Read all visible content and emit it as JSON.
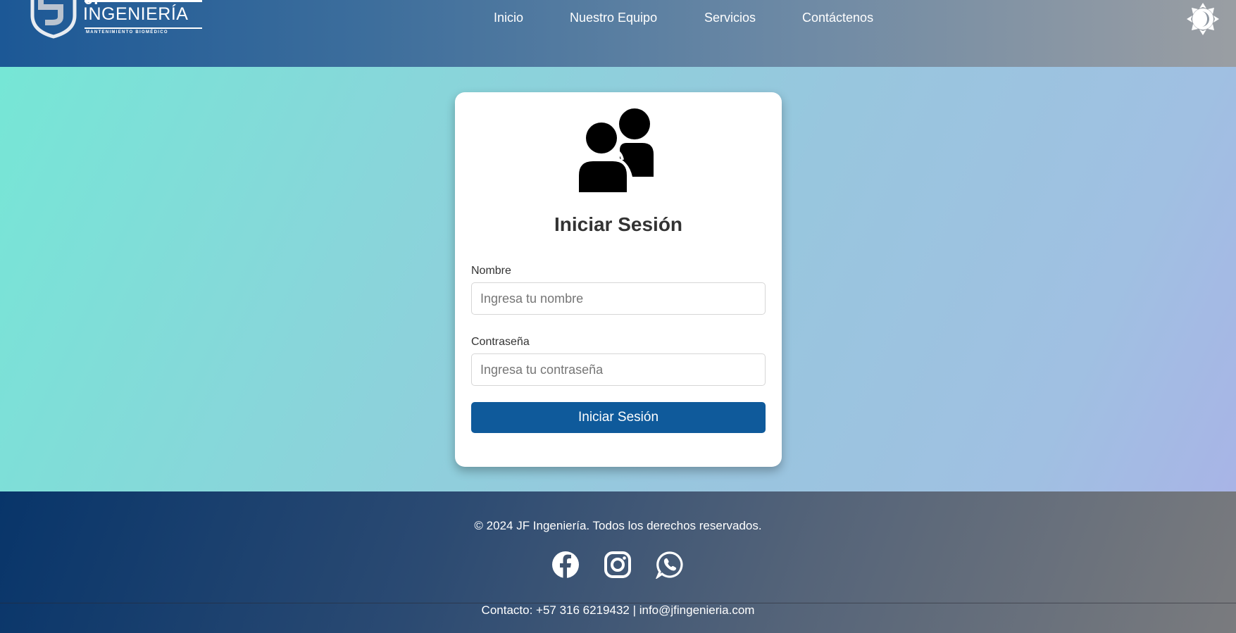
{
  "header": {
    "logo": {
      "brand_top": "JF",
      "brand_name": "INGENIERÍA",
      "tagline": "MANTENIMIENTO BIOMÉDICO"
    },
    "nav": [
      {
        "label": "Inicio"
      },
      {
        "label": "Nuestro Equipo"
      },
      {
        "label": "Servicios"
      },
      {
        "label": "Contáctenos"
      }
    ],
    "theme_toggle_icon": "sun-moon-icon"
  },
  "login": {
    "icon": "users-icon",
    "title": "Iniciar Sesión",
    "name_label": "Nombre",
    "name_placeholder": "Ingresa tu nombre",
    "name_value": "",
    "password_label": "Contraseña",
    "password_placeholder": "Ingresa tu contraseña",
    "password_value": "",
    "submit_label": "Iniciar Sesión"
  },
  "footer": {
    "copyright": "© 2024 JF Ingeniería. Todos los derechos reservados.",
    "social": [
      {
        "icon": "facebook-icon"
      },
      {
        "icon": "instagram-icon"
      },
      {
        "icon": "whatsapp-icon"
      }
    ],
    "contact": "Contacto: +57 316 6219432 | info@jfingenieria.com"
  },
  "colors": {
    "primary_button": "#0f5a9b",
    "header_start": "#1c5896",
    "main_start": "#76e6d6",
    "footer_start": "#08356a"
  }
}
